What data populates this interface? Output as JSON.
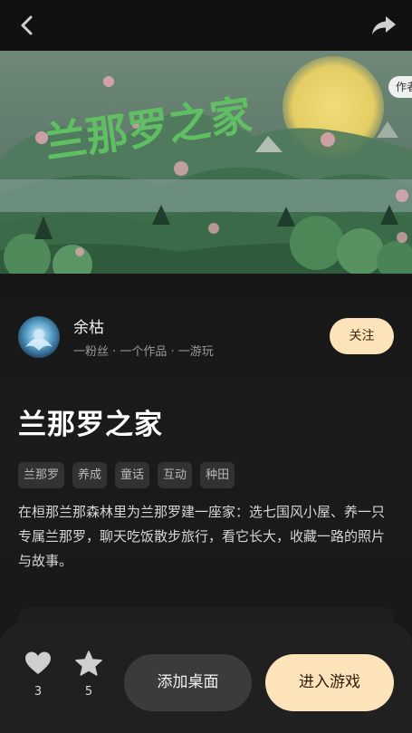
{
  "header": {
    "back_icon": "chevron-left-icon",
    "share_icon": "share-arrow-icon"
  },
  "banner": {
    "title_art_text": "兰那罗之家",
    "author_tag": "作者",
    "colors": {
      "sky": "#5f7a66",
      "hill": "#3e7a52",
      "sun": "#e9d26a",
      "petal": "#e8a9b6"
    }
  },
  "author": {
    "name": "余枯",
    "meta": "一粉丝 · 一个作品 · 一游玩",
    "follow_label": "关注"
  },
  "game": {
    "title": "兰那罗之家",
    "tags": [
      "兰那罗",
      "养成",
      "童话",
      "互动",
      "种田"
    ],
    "description": "在桓那兰那森林里为兰那罗建一座家：选七国风小屋、养一只专属兰那罗，聊天吃饭散步旅行，看它长大，收藏一路的照片与故事。"
  },
  "bottom": {
    "likes": "3",
    "favorites": "5",
    "add_desktop_label": "添加桌面",
    "play_label": "进入游戏"
  },
  "theme": {
    "accent": "#fde3b9",
    "background": "#141414"
  }
}
